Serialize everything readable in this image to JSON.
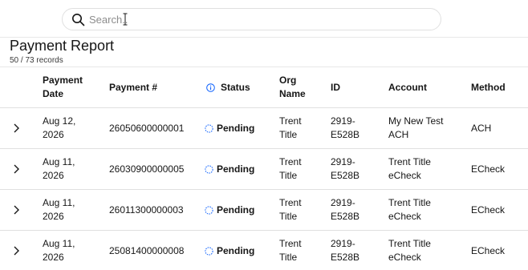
{
  "search": {
    "placeholder": "Search.."
  },
  "report": {
    "title": "Payment Report",
    "record_count": "50 / 73 records"
  },
  "table": {
    "columns": [
      {
        "key": "date",
        "label_line1": "Payment",
        "label_line2": "Date"
      },
      {
        "key": "number",
        "label": "Payment #"
      },
      {
        "key": "status",
        "label": "Status"
      },
      {
        "key": "org",
        "label_line1": "Org",
        "label_line2": "Name"
      },
      {
        "key": "id",
        "label": "ID"
      },
      {
        "key": "account",
        "label": "Account"
      },
      {
        "key": "method",
        "label": "Method"
      }
    ],
    "rows": [
      {
        "date_l1": "Aug 12,",
        "date_l2": "2026",
        "number": "26050600000001",
        "status": "Pending",
        "org_l1": "Trent",
        "org_l2": "Title",
        "id_l1": "2919-",
        "id_l2": "E528B",
        "account_l1": "My New Test",
        "account_l2": "ACH",
        "method": "ACH"
      },
      {
        "date_l1": "Aug 11,",
        "date_l2": "2026",
        "number": "26030900000005",
        "status": "Pending",
        "org_l1": "Trent",
        "org_l2": "Title",
        "id_l1": "2919-",
        "id_l2": "E528B",
        "account_l1": "Trent Title",
        "account_l2": "eCheck",
        "method": "ECheck"
      },
      {
        "date_l1": "Aug 11,",
        "date_l2": "2026",
        "number": "26011300000003",
        "status": "Pending",
        "org_l1": "Trent",
        "org_l2": "Title",
        "id_l1": "2919-",
        "id_l2": "E528B",
        "account_l1": "Trent Title",
        "account_l2": "eCheck",
        "method": "ECheck"
      },
      {
        "date_l1": "Aug 11,",
        "date_l2": "2026",
        "number": "25081400000008",
        "status": "Pending",
        "org_l1": "Trent",
        "org_l2": "Title",
        "id_l1": "2919-",
        "id_l2": "E528B",
        "account_l1": "Trent Title",
        "account_l2": "eCheck",
        "method": "ECheck"
      }
    ]
  },
  "icons": {
    "search": "search-icon",
    "expand": "chevron-right-icon",
    "info": "info-icon",
    "pending": "pending-status-icon"
  },
  "colors": {
    "info_blue": "#0f62fe",
    "pending_blue": "#0f62fe"
  }
}
